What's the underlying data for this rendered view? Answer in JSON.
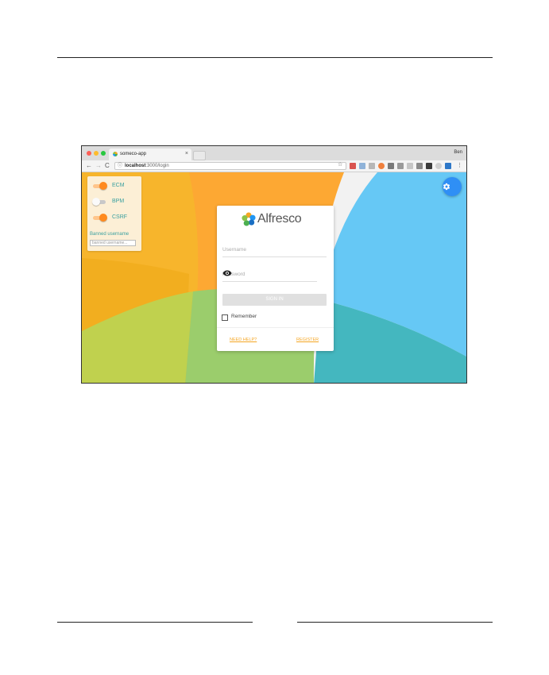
{
  "browser": {
    "tab_title": "someco-app",
    "tab_close": "×",
    "profile_name": "Ben",
    "url_host": "localhost",
    "url_path": ":3000/login",
    "nav": {
      "back": "←",
      "forward": "→",
      "reload": "C"
    }
  },
  "settings_panel": {
    "toggles": [
      {
        "label": "ECM",
        "on": true
      },
      {
        "label": "BPM",
        "on": false
      },
      {
        "label": "CSRF",
        "on": true
      }
    ],
    "banned_label": "Banned username",
    "banned_placeholder": "banned username..."
  },
  "login": {
    "logo_text": "Alfresco",
    "username_placeholder": "Username",
    "password_placeholder": "Password",
    "signin_label": "SIGN IN",
    "remember_label": "Remember",
    "need_help": "NEED HELP?",
    "register": "REGISTER"
  },
  "colors": {
    "accent_orange": "#ff8a1e",
    "link_orange": "#f5a623",
    "fab_blue": "#2f8ff5",
    "bg_sky": "#66c8f5",
    "bg_teal": "#44b7bf",
    "bg_yellow": "#f7b52c",
    "bg_orange": "#fda833",
    "bg_green": "#c0d14e"
  },
  "icons": {
    "settings_fab": "gear-icon",
    "password_toggle": "eye-icon",
    "star": "star-icon",
    "info": "info-icon"
  }
}
